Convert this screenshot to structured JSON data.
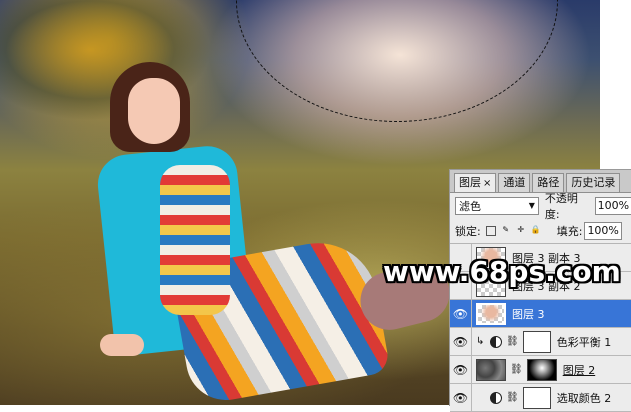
{
  "watermark": "www.68ps.com",
  "panel": {
    "tabs": [
      {
        "label": "图层",
        "close": "×",
        "active": true
      },
      {
        "label": "通道",
        "active": false
      },
      {
        "label": "路径",
        "active": false
      },
      {
        "label": "历史记录",
        "active": false
      }
    ],
    "blend_mode": "滤色",
    "opacity_label": "不透明度:",
    "opacity_value": "100%",
    "lock_label": "锁定:",
    "fill_label": "填充:",
    "fill_value": "100%",
    "layers": [
      {
        "name": "图层 3 副本 3",
        "visible": false,
        "selected": false
      },
      {
        "name": "图层 3 副本 2",
        "visible": false,
        "selected": false
      },
      {
        "name": "图层 3",
        "visible": true,
        "selected": true
      },
      {
        "name": "色彩平衡 1",
        "visible": true,
        "selected": false
      },
      {
        "name": "图层 2",
        "visible": true,
        "selected": false
      },
      {
        "name": "选取颜色 2",
        "visible": true,
        "selected": false
      }
    ]
  }
}
